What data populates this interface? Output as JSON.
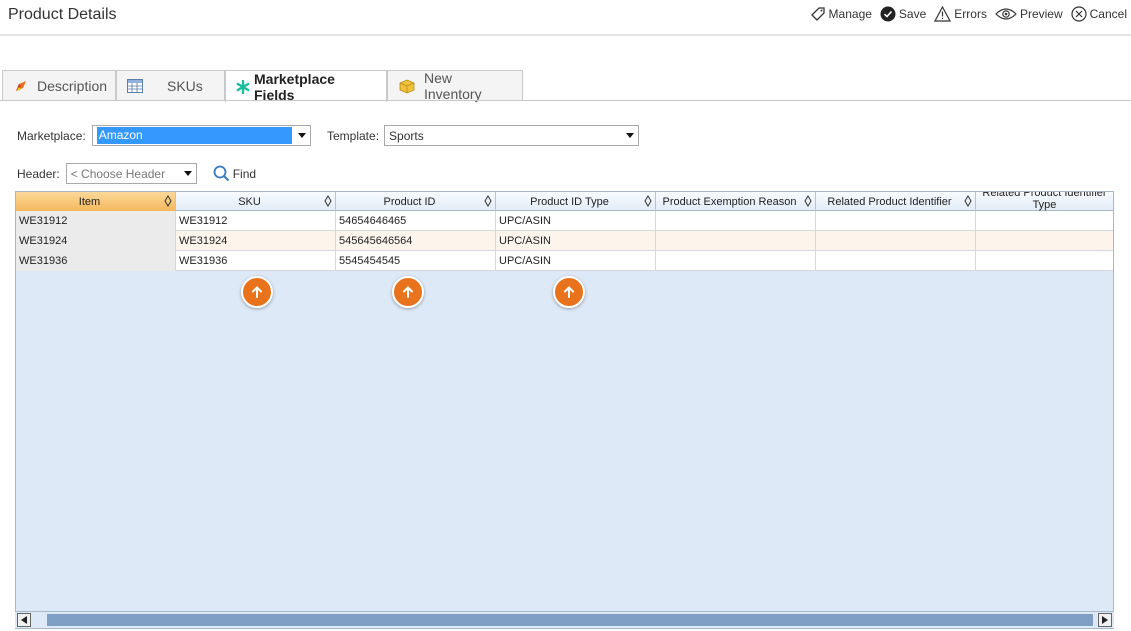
{
  "header": {
    "title": "Product Details",
    "actions": [
      {
        "label": "Manage",
        "icon": "manage-icon"
      },
      {
        "label": "Save",
        "icon": "check-circle-icon"
      },
      {
        "label": "Errors",
        "icon": "warning-icon"
      },
      {
        "label": "Preview",
        "icon": "eye-icon"
      },
      {
        "label": "Cancel",
        "icon": "cancel-icon"
      }
    ]
  },
  "tabs": [
    {
      "label": "Description",
      "icon": "description-icon"
    },
    {
      "label": "SKUs",
      "icon": "skus-icon"
    },
    {
      "label": "Marketplace Fields",
      "icon": "asterisk-icon",
      "active": true
    },
    {
      "label": "New Inventory",
      "icon": "inventory-box-icon"
    }
  ],
  "form": {
    "marketplace_label": "Marketplace:",
    "marketplace_value": "Amazon",
    "template_label": "Template:",
    "template_value": "Sports",
    "header_label": "Header:",
    "header_placeholder": "< Choose Header",
    "find_label": "Find"
  },
  "grid": {
    "columns": [
      "Item",
      "SKU",
      "Product ID",
      "Product ID Type",
      "Product Exemption Reason",
      "Related Product Identifier",
      "Related Product Identifier Type"
    ],
    "rows": [
      [
        "WE31912",
        "WE31912",
        "54654646465",
        "UPC/ASIN",
        "",
        "",
        ""
      ],
      [
        "WE31924",
        "WE31924",
        "545645646564",
        "UPC/ASIN",
        "",
        "",
        ""
      ],
      [
        "WE31936",
        "WE31936",
        "5545454545",
        "UPC/ASIN",
        "",
        "",
        ""
      ]
    ]
  },
  "colors": {
    "accent_orange": "#e8731c",
    "selection_blue": "#3399ff",
    "grid_background": "#dde9f7",
    "selected_header": "#f4b75b"
  }
}
